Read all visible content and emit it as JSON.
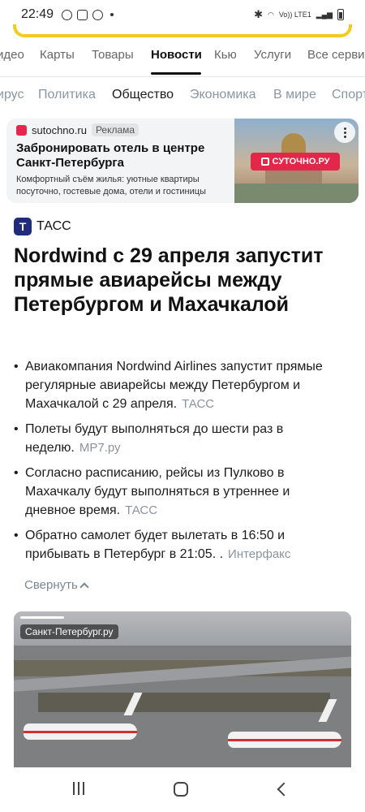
{
  "status_bar": {
    "time": "22:49",
    "network_label": "Vo)) LTE1"
  },
  "services": [
    {
      "label": "идео",
      "active": false
    },
    {
      "label": "Карты",
      "active": false
    },
    {
      "label": "Товары",
      "active": false
    },
    {
      "label": "Новости",
      "active": true
    },
    {
      "label": "Кью",
      "active": false
    },
    {
      "label": "Услуги",
      "active": false
    },
    {
      "label": "Все серви",
      "active": false
    }
  ],
  "categories": [
    {
      "label": "ирус",
      "active": false
    },
    {
      "label": "Политика",
      "active": false
    },
    {
      "label": "Общество",
      "active": true
    },
    {
      "label": "Экономика",
      "active": false
    },
    {
      "label": "В мире",
      "active": false
    },
    {
      "label": "Спорт",
      "active": false
    }
  ],
  "ad": {
    "domain": "sutochno.ru",
    "badge": "Реклама",
    "title": "Забронировать отель в центре Санкт-Петербурга",
    "description": "Комфортный съём жилья: уютные квартиры посуточно, гостевые дома, отели и гостиницы",
    "logo_text": "СУТОЧНО.РУ"
  },
  "article": {
    "source": "ТАСС",
    "source_logo_letter": "T",
    "headline": "Nordwind с 29 апреля запустит прямые авиарейсы между Петербургом и Махачкалой",
    "bullets": [
      {
        "text": "Авиакомпания Nordwind Airlines запустит прямые регулярные авиарейсы между Петербургом и Махачкалой с 29 апреля.",
        "source": "ТАСС"
      },
      {
        "text": "Полеты будут выполняться до шести раз в неделю.",
        "source": "MP7.ру"
      },
      {
        "text": "Согласно расписанию, рейсы из Пулково в Махачкалу будут выполняться в утреннее и дневное время.",
        "source": "ТАСС"
      },
      {
        "text": "Обратно самолет будет вылетать в 16:50 и прибывать в Петербург в 21:05. .",
        "source": "Интерфакс"
      }
    ],
    "collapse_label": "Свернуть",
    "photo_label": "Санкт-Петербург.ру"
  },
  "colors": {
    "accent_yellow": "#f2cc1c",
    "tass_blue": "#1f2b7b",
    "sutochno_red": "#e3264a",
    "muted_text": "#8a96a0"
  }
}
